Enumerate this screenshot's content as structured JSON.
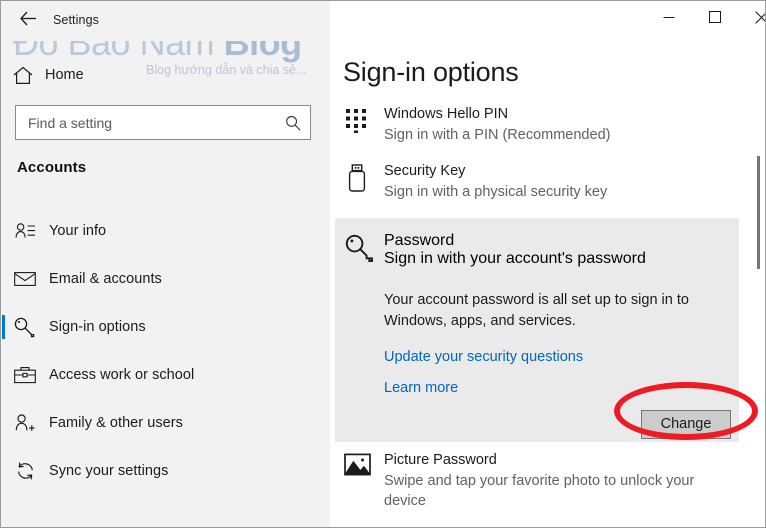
{
  "window": {
    "app_title": "Settings",
    "back_icon": "back-arrow-icon",
    "controls": {
      "minimize": "minimize-icon",
      "maximize": "maximize-icon",
      "close": "close-icon"
    }
  },
  "watermark": {
    "main_normal": "Đỗ Bảo Nam ",
    "main_bold": "Blog",
    "subtitle": "Blog hướng dẫn và chia sẻ..."
  },
  "sidebar": {
    "home_label": "Home",
    "home_icon": "home-icon",
    "search": {
      "placeholder": "Find a setting",
      "value": "",
      "icon": "search-icon"
    },
    "heading": "Accounts",
    "items": [
      {
        "label": "Your info",
        "icon": "person-info-icon",
        "selected": false
      },
      {
        "label": "Email & accounts",
        "icon": "envelope-icon",
        "selected": false
      },
      {
        "label": "Sign-in options",
        "icon": "key-icon",
        "selected": true
      },
      {
        "label": "Access work or school",
        "icon": "briefcase-icon",
        "selected": false
      },
      {
        "label": "Family & other users",
        "icon": "person-add-icon",
        "selected": false
      },
      {
        "label": "Sync your settings",
        "icon": "sync-icon",
        "selected": false
      }
    ]
  },
  "main": {
    "title": "Sign-in options",
    "options": [
      {
        "name": "Windows Hello PIN",
        "desc": "Sign in with a PIN (Recommended)",
        "icon": "pin-keypad-icon"
      },
      {
        "name": "Security Key",
        "desc": "Sign in with a physical security key",
        "icon": "usb-security-key-icon"
      },
      {
        "name": "Picture Password",
        "desc": "Swipe and tap your favorite photo to unlock your device",
        "icon": "picture-icon"
      }
    ],
    "password_section": {
      "name": "Password",
      "desc": "Sign in with your account's password",
      "icon": "key-icon",
      "status_text": "Your account password is all set up to sign in to Windows, apps, and services.",
      "link_security_questions": "Update your security questions",
      "link_learn_more": "Learn more",
      "change_button": "Change"
    }
  },
  "annotation": {
    "shape": "ellipse",
    "color": "#ee1b22",
    "targets": "change-button"
  },
  "colors": {
    "accent": "#0078d7",
    "link": "#0067c0",
    "sidebar_bg": "#f2f2f2",
    "panel_highlight": "#eaeaea",
    "button_face": "#cccccc",
    "annotation_red": "#ee1b22",
    "watermark_blue": "#b9c9dc"
  }
}
